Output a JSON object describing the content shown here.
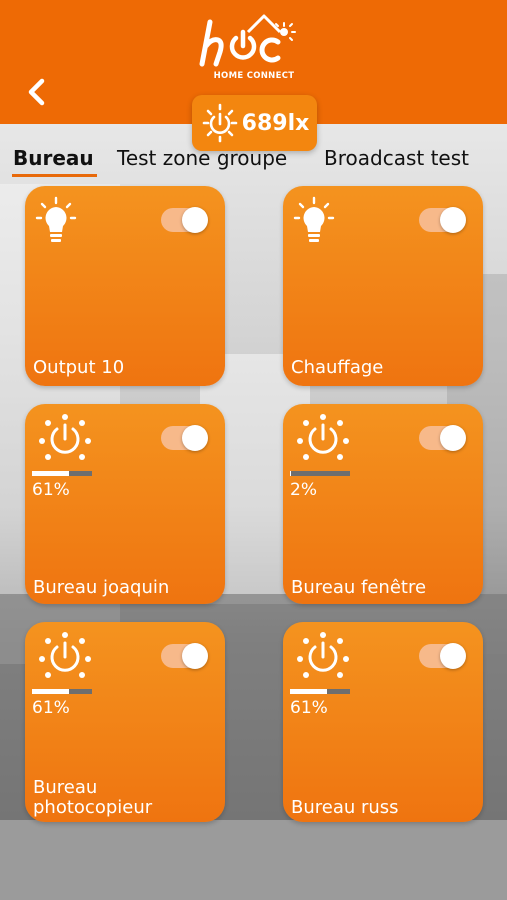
{
  "header": {
    "logo_brand": "hOC",
    "logo_subtitle": "HOME CONNECT",
    "back_icon": "chevron-left-icon"
  },
  "lux": {
    "value": "689lx",
    "icon": "sun-dial-icon"
  },
  "tabs": [
    {
      "label": "Bureau",
      "active": true
    },
    {
      "label": "Test zone groupe",
      "active": false
    },
    {
      "label": "Broadcast test",
      "active": false
    }
  ],
  "cards": [
    {
      "label": "Output 10",
      "icon": "lightbulb-icon",
      "on": true,
      "type": "switch"
    },
    {
      "label": "Chauffage",
      "icon": "lightbulb-icon",
      "on": true,
      "type": "switch"
    },
    {
      "label": "Bureau joaquin",
      "icon": "dimmer-icon",
      "on": true,
      "type": "dimmer",
      "level": 61,
      "level_text": "61%"
    },
    {
      "label": "Bureau fenêtre",
      "icon": "dimmer-icon",
      "on": true,
      "type": "dimmer",
      "level": 2,
      "level_text": "2%"
    },
    {
      "label": "Bureau\nphotocopieur",
      "icon": "dimmer-icon",
      "on": true,
      "type": "dimmer",
      "level": 61,
      "level_text": "61%"
    },
    {
      "label": "Bureau russ",
      "icon": "dimmer-icon",
      "on": true,
      "type": "dimmer",
      "level": 61,
      "level_text": "61%"
    }
  ],
  "colors": {
    "header": "#ee6a05",
    "card": "#f4931f",
    "accent": "#e8690a"
  }
}
